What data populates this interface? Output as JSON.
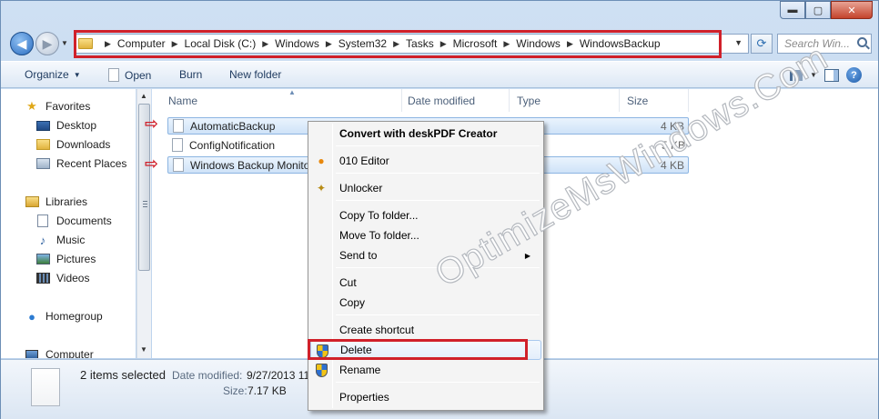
{
  "window": {
    "controls": {
      "minimize": "▬",
      "maximize": "▢",
      "close": "✕"
    }
  },
  "address": {
    "breadcrumbs": [
      "Computer",
      "Local Disk (C:)",
      "Windows",
      "System32",
      "Tasks",
      "Microsoft",
      "Windows",
      "WindowsBackup"
    ],
    "search_placeholder": "Search Win..."
  },
  "toolbar": {
    "organize": "Organize",
    "open": "Open",
    "burn": "Burn",
    "new_folder": "New folder"
  },
  "navigation": {
    "favorites": "Favorites",
    "desktop": "Desktop",
    "downloads": "Downloads",
    "recent_places": "Recent Places",
    "libraries": "Libraries",
    "documents": "Documents",
    "music": "Music",
    "pictures": "Pictures",
    "videos": "Videos",
    "homegroup": "Homegroup",
    "computer": "Computer"
  },
  "columns": {
    "name": "Name",
    "date_modified": "Date modified",
    "type": "Type",
    "size": "Size"
  },
  "files": [
    {
      "name": "AutomaticBackup",
      "size": "4 KB",
      "selected": true
    },
    {
      "name": "ConfigNotification",
      "size": "5 KB",
      "selected": false
    },
    {
      "name": "Windows Backup Monitor",
      "size": "4 KB",
      "selected": true
    }
  ],
  "details": {
    "summary": "2 items selected",
    "date_label": "Date modified:",
    "date_value": "9/27/2013 11",
    "size_label": "Size:",
    "size_value": "7.17 KB"
  },
  "context_menu": {
    "convert": "Convert with deskPDF Creator",
    "editor": "010 Editor",
    "unlocker": "Unlocker",
    "copy_to": "Copy To folder...",
    "move_to": "Move To folder...",
    "send_to": "Send to",
    "cut": "Cut",
    "copy": "Copy",
    "create_shortcut": "Create shortcut",
    "delete": "Delete",
    "rename": "Rename",
    "properties": "Properties"
  },
  "watermark": "OptimizeMsWindows.Com",
  "colors": {
    "annotation_red": "#d0202a",
    "selection_blue": "#cfe3f8"
  }
}
